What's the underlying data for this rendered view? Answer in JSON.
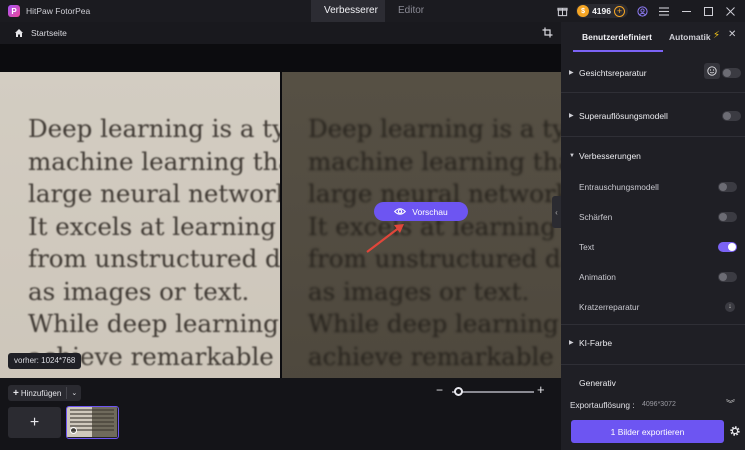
{
  "app": {
    "title": "HitPaw FotorPea"
  },
  "tabs": [
    {
      "label": "Verbesserer",
      "active": true
    },
    {
      "label": "Editor",
      "active": false
    }
  ],
  "credits": {
    "value": "4196"
  },
  "breadcrumb": {
    "label": "Startseite"
  },
  "preview": {
    "button_label": "Vorschau",
    "size_label": "vorher: 1024*768",
    "text_lines": [
      "Deep learning is a type",
      "machine learning that u",
      "large neural networks.",
      "It excels at learning patt",
      "from unstructured data",
      "as images or text.",
      "While deep learning can",
      "achieve remarkable resu"
    ],
    "after_text_lines": [
      "Deep learning is a type",
      "machine learning that u",
      "large neural networks.",
      "It excels at learning pat",
      "from unstructured data",
      "as images or text.",
      "While deep learning car",
      "achieve remarkable resu"
    ]
  },
  "bottom": {
    "add_label": "Hinzufügen",
    "add_tile": "+"
  },
  "panel": {
    "tab_custom": "Benutzerdefiniert",
    "tab_auto": "Automatik",
    "sections": {
      "face": {
        "label": "Gesichtsreparatur",
        "enabled": false
      },
      "superres": {
        "label": "Superauflösungsmodell",
        "enabled": false
      },
      "improvements": {
        "label": "Verbesserungen",
        "items": [
          {
            "label": "Entrauschungsmodell",
            "enabled": false
          },
          {
            "label": "Schärfen",
            "enabled": false
          },
          {
            "label": "Text",
            "enabled": true
          },
          {
            "label": "Animation",
            "enabled": false
          },
          {
            "label": "Kratzerreparatur"
          }
        ]
      },
      "ki_color": {
        "label": "KI-Farbe"
      },
      "generative": {
        "label": "Generativ"
      }
    },
    "export": {
      "label": "Exportauflösung :",
      "value": "4096*3072",
      "button_label": "1 Bilder exportieren"
    }
  },
  "colors": {
    "accent": "#6d55f2",
    "coin": "#f5a524"
  }
}
